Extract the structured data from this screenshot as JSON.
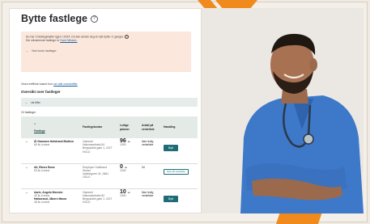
{
  "page": {
    "title": "Bytte fastlege",
    "help_symbol": "?"
  },
  "notice": {
    "line1": "Du har 2 fastlegebytter igjen i 2024. Du kan ønske deg et nytt bytte i 2 ganger.",
    "line2_prefix": "Din nåværende fastlege er",
    "line2_link": "Gard Nilssen.",
    "help_symbol": "?",
    "expand_label": "Vise konto fastleger"
  },
  "update_line": {
    "text": "Vises treffliste basert fors",
    "link": "ser alle overskrifter"
  },
  "overview": {
    "heading": "Oversikt over fastleger"
  },
  "filter": {
    "label": "vis filter"
  },
  "count": "24 fastleger",
  "table": {
    "sort_label": "A",
    "headers": [
      "Fastlege",
      "Fastlegekontor",
      "Ledige plasser",
      "Antall på venteliste",
      "Handling"
    ],
    "rows": [
      {
        "name": "Ål Gammes Hofstrand Bluthen",
        "sub": "69 år, kvinne",
        "office_line1": "Gammel",
        "office_line2": "Hakonsenbakk 84",
        "office_line3": "Bergskollie gate 1, 2227",
        "office_line4": "HOLD",
        "capacity": "96",
        "capacity_unit": "av",
        "capacity_sub": "1000",
        "waitlist": "Ikke ledig venteliste",
        "action": "Bytt"
      },
      {
        "name": "Ali, Eknes Bons",
        "sub": "53 år, kvinne",
        "office_line1": "Employer Hofstrand",
        "office_line2": "Senter",
        "office_line3": "Valdringmer 31, 0661",
        "office_line4": "OSLO",
        "capacity": "0",
        "capacity_unit": "av",
        "capacity_sub": "1000",
        "waitlist": "34",
        "action": "Sett på venteliste"
      },
      {
        "name": "Aarle, Angelo Mennier",
        "sub": "40 år, kvinne",
        "name2": "Hafsorand, Jåbere Mavor",
        "sub2": "48 år, kvinne",
        "office_line1": "Gammel",
        "office_line2": "Hakonsenbakk 82",
        "office_line3": "Bergskollie gate 1, 2227",
        "office_line4": "HOLD",
        "capacity": "10",
        "capacity_unit": "av",
        "capacity_sub": "1000",
        "waitlist": "Ikke ledig venteliste",
        "action": "Bytt"
      }
    ]
  },
  "colors": {
    "accent_orange": "#f08a1c",
    "notice_bg": "#fbe7dc",
    "primary_button": "#1f6b76",
    "header_bg": "#e4ebe7"
  },
  "icons": {
    "help": "help-circle-icon",
    "expand": "chevron-down-icon",
    "row_toggle": "chevron-down-icon"
  }
}
